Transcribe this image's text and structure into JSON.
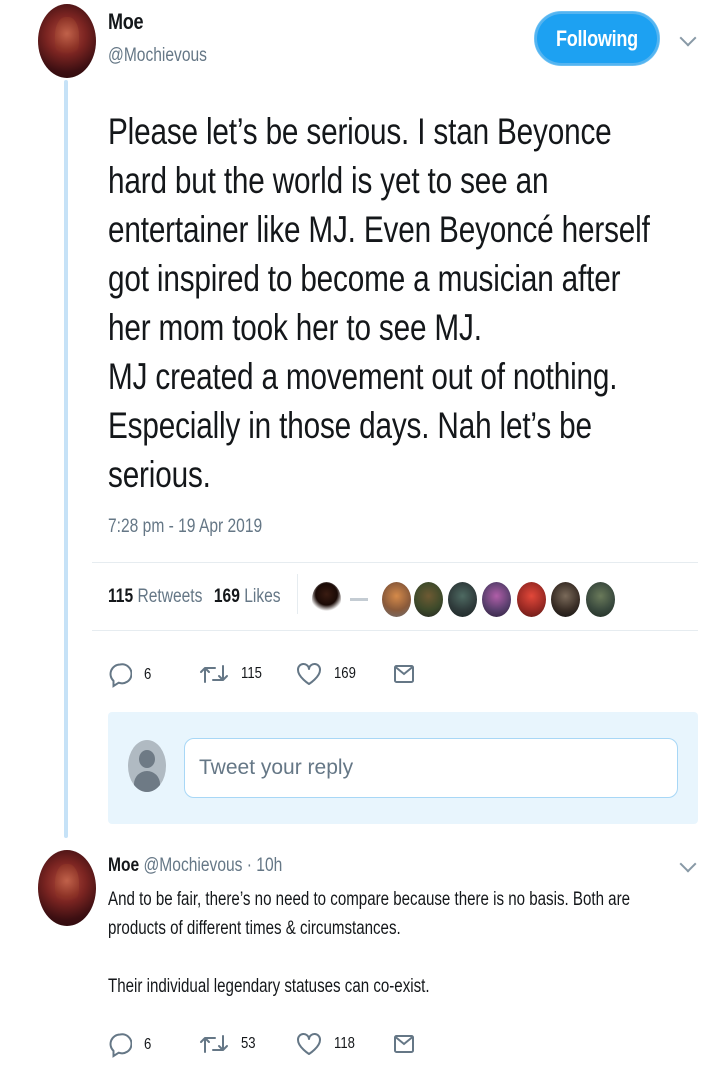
{
  "tweet": {
    "author_name": "Moe",
    "author_handle": "@Mochievous",
    "follow_label": "Following",
    "text_lines": [
      "Please let’s be serious. I stan Beyonce",
      "hard but the world is yet to see an",
      "entertainer like MJ. Even Beyoncé herself",
      "got inspired to become a musician after",
      "her mom took her to see MJ.",
      "MJ created a movement out of nothing.",
      "Especially in those days. Nah let’s be",
      "serious."
    ],
    "timestamp": "7:28 pm - 19 Apr 2019",
    "retweets_count": "115",
    "retweets_label": "Retweets",
    "likes_count": "169",
    "likes_label": "Likes",
    "actions": {
      "replies": "6",
      "retweets": "115",
      "likes": "169"
    }
  },
  "reply_box": {
    "placeholder": "Tweet your reply"
  },
  "reply": {
    "author_name": "Moe",
    "author_handle": "@Mochievous",
    "separator": "·",
    "time": "10h",
    "text_lines": [
      "And to be fair, there’s no need to compare because there is no basis. Both are",
      "products of different times & circumstances.",
      "",
      "Their individual legendary statuses can co-exist."
    ],
    "actions": {
      "replies": "6",
      "retweets": "53",
      "likes": "118"
    }
  },
  "colors": {
    "accent": "#1da1f2",
    "thread_line": "#c6e2f7",
    "muted": "#657786",
    "reply_box_bg": "#e8f5fd"
  },
  "icons": [
    "reply-icon",
    "retweet-icon",
    "like-icon",
    "direct-message-icon",
    "chevron-down-icon"
  ]
}
